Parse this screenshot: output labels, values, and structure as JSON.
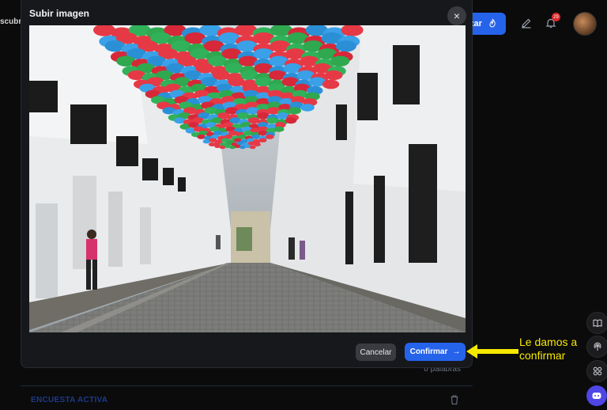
{
  "background": {
    "nav_text": "scubr",
    "action_button_label": "zar",
    "notification_count": "29",
    "word_count": "0 palabras",
    "survey_label": "ENCUESTA ACTIVA"
  },
  "modal": {
    "title": "Subir imagen",
    "close_label": "×",
    "cancel_label": "Cancelar",
    "confirm_label": "Confirmar",
    "confirm_arrow": "→"
  },
  "annotation": {
    "text_line1": "Le damos a",
    "text_line2": "confirmar",
    "color": "#f7e800"
  },
  "colors": {
    "primary": "#2563eb",
    "modal_bg": "#17181c",
    "page_bg": "#0b0b0c",
    "badge": "#dc2626"
  },
  "icons": {
    "close": "close-icon",
    "arrow": "arrow-right-icon",
    "flame": "flame-icon",
    "edit": "pencil-icon",
    "bell": "bell-icon",
    "trash": "trash-icon",
    "book": "book-icon",
    "podcast": "podcast-icon",
    "apps": "apps-icon",
    "bot": "bot-icon"
  }
}
